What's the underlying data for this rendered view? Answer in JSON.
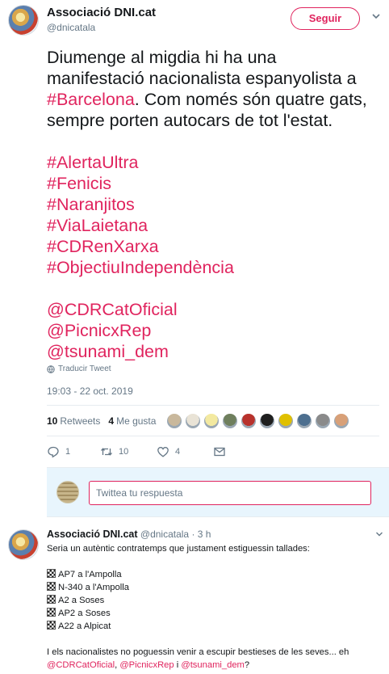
{
  "tweet": {
    "account_name": "Associació DNI.cat",
    "handle": "@dnicatala",
    "follow_label": "Seguir",
    "text_lines": [
      {
        "parts": [
          {
            "t": "Diumenge al migdia hi ha una",
            "link": false
          }
        ]
      },
      {
        "parts": [
          {
            "t": "manifestació nacionalista espanyolista a",
            "link": false
          }
        ]
      },
      {
        "parts": [
          {
            "t": "#Barcelona",
            "link": true
          },
          {
            "t": ". Com només són quatre gats,",
            "link": false
          }
        ]
      },
      {
        "parts": [
          {
            "t": "sempre porten autocars de tot l'estat.",
            "link": false
          }
        ]
      },
      {
        "gap": true
      },
      {
        "parts": [
          {
            "t": "#AlertaUltra",
            "link": true
          }
        ]
      },
      {
        "parts": [
          {
            "t": "#Fenicis",
            "link": true
          }
        ]
      },
      {
        "parts": [
          {
            "t": "#Naranjitos",
            "link": true
          }
        ]
      },
      {
        "parts": [
          {
            "t": "#ViaLaietana",
            "link": true
          }
        ]
      },
      {
        "parts": [
          {
            "t": "#CDRenXarxa",
            "link": true
          }
        ]
      },
      {
        "parts": [
          {
            "t": "#ObjectiuIndependència",
            "link": true
          }
        ]
      },
      {
        "gap": true
      },
      {
        "parts": [
          {
            "t": "@CDRCatOficial",
            "link": true
          }
        ]
      },
      {
        "parts": [
          {
            "t": "@PicnicxRep",
            "link": true
          }
        ]
      },
      {
        "parts": [
          {
            "t": "@tsunami_dem",
            "link": true
          }
        ]
      }
    ],
    "translate_label": "Traducir Tweet",
    "timestamp": "19:03 - 22 oct. 2019",
    "retweets_count": "10",
    "retweets_label": "Retweets",
    "likes_count": "4",
    "likes_label": "Me gusta",
    "liker_avatars": [
      "#c9b89c",
      "#e9e3d6",
      "#f3e9a0",
      "#6f7f5d",
      "#b8322c",
      "#1f1f1f",
      "#e0c000",
      "#4d6f8f",
      "#8a8a8a",
      "#d8a078"
    ],
    "action_reply_count": "1",
    "action_retweet_count": "10",
    "action_like_count": "4",
    "reply_placeholder": "Twittea tu respuesta"
  },
  "reply": {
    "account_name": "Associació DNI.cat",
    "handle": "@dnicatala",
    "time": "· 3 h",
    "lines": [
      {
        "text": "Seria un autèntic contratemps que justament estiguessin tallades:"
      },
      {
        "gap": true
      },
      {
        "flag": true,
        "text": "AP7 a l'Ampolla"
      },
      {
        "flag": true,
        "text": "N-340 a l'Ampolla"
      },
      {
        "flag": true,
        "text": "A2 a Soses"
      },
      {
        "flag": true,
        "text": "AP2 a Soses"
      },
      {
        "flag": true,
        "text": "A22 a Alpicat"
      },
      {
        "gap": true
      },
      {
        "text": "I els nacionalistes no poguessin venir a escupir bestieses de les seves... eh"
      }
    ],
    "mention_1": "@CDRCatOficial",
    "mention_2": "@PicnicxRep",
    "mention_3": "@tsunami_dem",
    "sep_1": ", ",
    "sep_2": " i ",
    "end": "?"
  },
  "colors": {
    "accent": "#e0245e",
    "text": "#14171a",
    "muted": "#657786",
    "reply_bg": "#e8f5fd"
  }
}
